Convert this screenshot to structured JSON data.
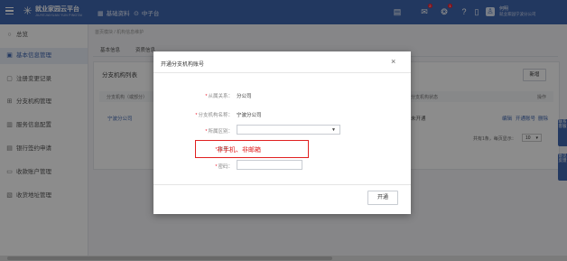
{
  "header": {
    "logo_text": "就业家园云平台",
    "logo_sub": "JIUYEJIAYUAN YUN PINGTAI",
    "nav": [
      {
        "icon": "grid-icon",
        "label": "基础资料"
      },
      {
        "icon": "location-icon",
        "label": "中子台"
      }
    ],
    "badges": {
      "bell": "2",
      "message": "1"
    },
    "user_name": "何明",
    "user_org": "就业家园宁波分公司"
  },
  "sidebar": {
    "items": [
      {
        "icon": "circle-icon",
        "label": "总览",
        "active": false
      },
      {
        "icon": "building-icon",
        "label": "基本信息管理",
        "active": true
      },
      {
        "icon": "doc-icon",
        "label": "注册变更记录",
        "active": false
      },
      {
        "icon": "org-icon",
        "label": "分支机构管理",
        "active": false
      },
      {
        "icon": "service-icon",
        "label": "服务信息配置",
        "active": false
      },
      {
        "icon": "bank-icon",
        "label": "银行签约申请",
        "active": false
      },
      {
        "icon": "account-icon",
        "label": "收款账户管理",
        "active": false
      },
      {
        "icon": "address-icon",
        "label": "收货地址管理",
        "active": false
      }
    ]
  },
  "breadcrumb": "首页模块 / 机构信息维护",
  "tabs": [
    "基本信息",
    "资质信息"
  ],
  "panel": {
    "title": "分支机构列表",
    "new_button": "新增",
    "columns": [
      "分支机构（或部分）",
      "分支机构状态",
      "操作"
    ],
    "row": {
      "name": "宁波分公司",
      "status": "未开通",
      "actions": [
        "编辑",
        "开通账号",
        "删除"
      ]
    },
    "pager_text": "共有1条，每页显示：",
    "page_size": "10"
  },
  "modal": {
    "title": "开通分支机构账号",
    "close": "×",
    "fields": [
      {
        "label": "从属关系：",
        "value": "分公司",
        "required": true
      },
      {
        "label": "分支机构名称：",
        "value": "宁波分公司",
        "required": true
      },
      {
        "label": "所属区别：",
        "value": "",
        "required": true
      },
      {
        "label": "账号：",
        "value": "",
        "required": true
      },
      {
        "label": "密码：",
        "value": "",
        "required": true
      }
    ],
    "annotation": "非手机、非邮箱",
    "submit": "开通"
  },
  "float": [
    "联系客服",
    "意见反馈"
  ],
  "colors": {
    "brand": "#3f66b0",
    "annotation": "#e02020"
  }
}
